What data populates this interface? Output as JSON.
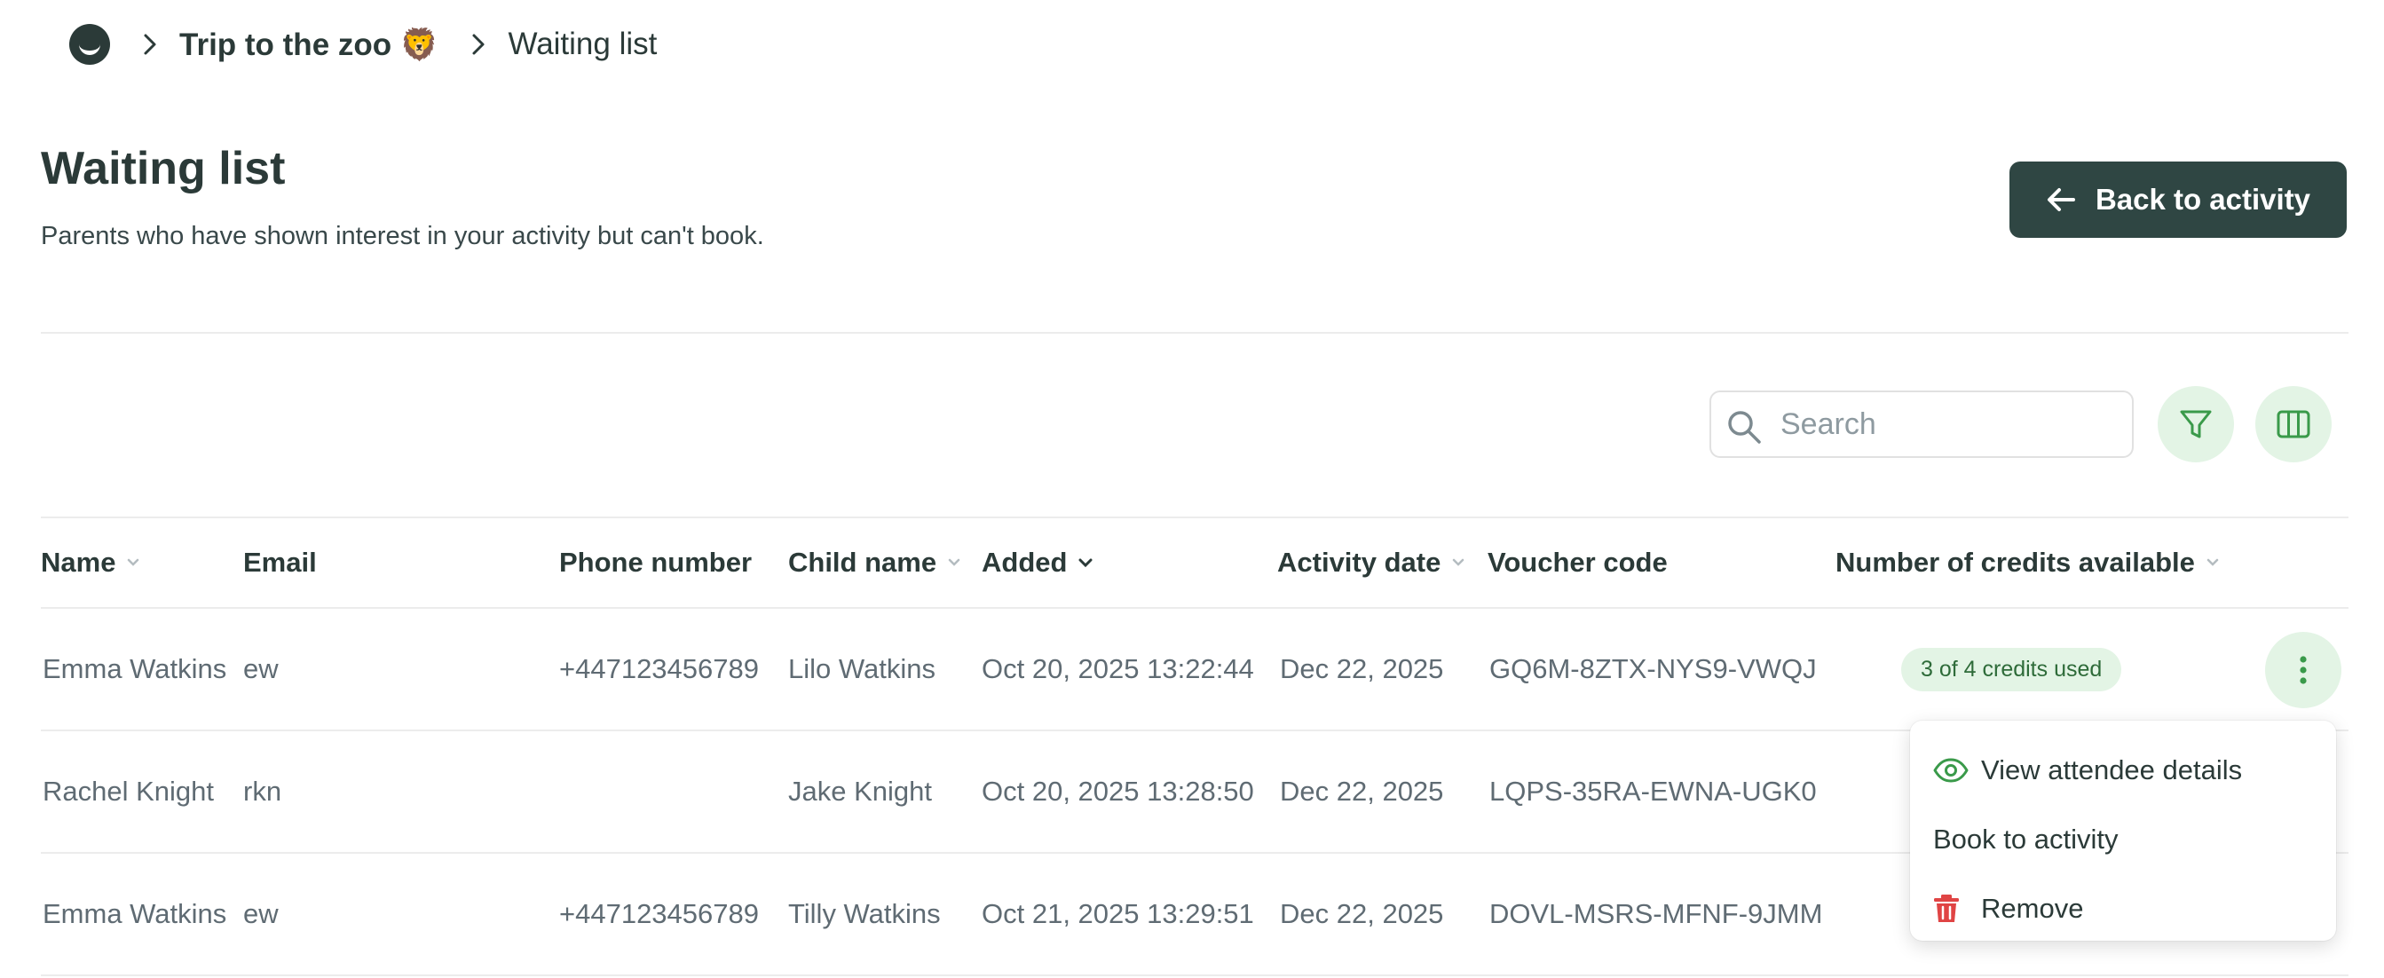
{
  "breadcrumb": {
    "logo_icon": "smile-logo-icon",
    "separator_icon": "chevron-right-icon",
    "items": [
      "Trip to the zoo 🦁",
      "Waiting list"
    ]
  },
  "page": {
    "title": "Waiting list",
    "subtitle": "Parents who have shown interest in your activity but can't book.",
    "back_button": "Back to activity"
  },
  "toolbar": {
    "search_placeholder": "Search",
    "filter_icon": "filter-icon",
    "columns_icon": "columns-icon"
  },
  "table": {
    "columns": [
      "Name",
      "Email",
      "Phone number",
      "Child name",
      "Added",
      "Activity date",
      "Voucher code",
      "Number of credits available"
    ],
    "rows": [
      {
        "name": "Emma Watkins",
        "email": "ew",
        "phone": "+447123456789",
        "child": "Lilo Watkins",
        "added": "Oct 20, 2025 13:22:44",
        "activity_date": "Dec 22, 2025",
        "voucher": "GQ6M-8ZTX-NYS9-VWQJ",
        "credits": "3 of 4 credits used"
      },
      {
        "name": "Rachel Knight",
        "email": "rkn",
        "phone": "",
        "child": "Jake Knight",
        "added": "Oct 20, 2025 13:28:50",
        "activity_date": "Dec 22, 2025",
        "voucher": "LQPS-35RA-EWNA-UGK0",
        "credits": ""
      },
      {
        "name": "Emma Watkins",
        "email": "ew",
        "phone": "+447123456789",
        "child": "Tilly Watkins",
        "added": "Oct 21, 2025 13:29:51",
        "activity_date": "Dec 22, 2025",
        "voucher": "DOVL-MSRS-MFNF-9JMM",
        "credits": ""
      }
    ]
  },
  "row_menu": {
    "view": "View attendee details",
    "book": "Book to activity",
    "remove": "Remove"
  },
  "colors": {
    "primary": "#2f4643",
    "accent_green": "#3a9a4a",
    "accent_bg": "#e3f4e5",
    "danger": "#e04444"
  }
}
